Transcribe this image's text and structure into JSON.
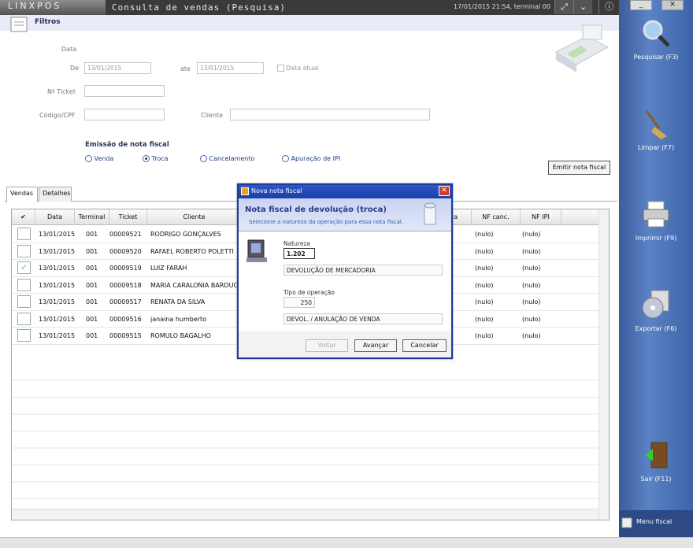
{
  "app": {
    "logo": "LINXPOS",
    "title": "Consulta de vendas (Pesquisa)",
    "status": "17/01/2015 21:54, terminal 00"
  },
  "titlebar_buttons": {
    "expand": "⤢",
    "collapse": "⌄",
    "info": "ⓘ"
  },
  "sidebar": {
    "window_minimize": "_",
    "window_close": "✕",
    "items": [
      {
        "label": "Pesquisar (F3)",
        "icon": "magnifier-icon"
      },
      {
        "label": "Limpar (F7)",
        "icon": "broom-icon"
      },
      {
        "label": "Imprimir (F9)",
        "icon": "printer-icon"
      },
      {
        "label": "Exportar (F6)",
        "icon": "disc-icon"
      },
      {
        "label": "Sair (F11)",
        "icon": "exit-door-icon"
      }
    ],
    "menu_label": "Menu fiscal"
  },
  "filtros": {
    "title": "Filtros",
    "data_label": "Data",
    "de_label": "De",
    "de_value": "13/01/2015",
    "ate_label": "ate",
    "ate_value": "13/01/2015",
    "data_atual_label": "Data atual",
    "ticket_label": "Nº Ticket",
    "codigo_label": "Código/CPF",
    "cliente_label": "Cliente",
    "emissao_label": "Emissão de nota fiscal",
    "radios": [
      "Venda",
      "Troca",
      "Cancelamento",
      "Apuração de IPI"
    ],
    "selected_radio": "Troca",
    "emitir_button": "Emitir nota fiscal"
  },
  "tabs": [
    "Vendas",
    "Detalhes"
  ],
  "grid": {
    "columns": [
      "✔",
      "Data",
      "Terminal",
      "Ticket",
      "Cliente",
      "ca",
      "NF canc.",
      "NF IPI"
    ],
    "rows": [
      {
        "checked": false,
        "data": "13/01/2015",
        "terminal": "001",
        "ticket": "00009521",
        "cliente": "RODRIGO GONÇALVES",
        "nf_canc": "(nulo)",
        "nf_ipi": "(nulo)"
      },
      {
        "checked": false,
        "data": "13/01/2015",
        "terminal": "001",
        "ticket": "00009520",
        "cliente": "RAFAEL ROBERTO POLETTI",
        "nf_canc": "(nulo)",
        "nf_ipi": "(nulo)"
      },
      {
        "checked": true,
        "data": "13/01/2015",
        "terminal": "001",
        "ticket": "00009519",
        "cliente": "LUIZ FARAH",
        "nf_canc": "(nulo)",
        "nf_ipi": "(nulo)"
      },
      {
        "checked": false,
        "data": "13/01/2015",
        "terminal": "001",
        "ticket": "00009518",
        "cliente": "MARIA CARALONIA BARDUCO",
        "nf_canc": "(nulo)",
        "nf_ipi": "(nulo)"
      },
      {
        "checked": false,
        "data": "13/01/2015",
        "terminal": "001",
        "ticket": "00009517",
        "cliente": "RENATA DA SILVA",
        "nf_canc": "(nulo)",
        "nf_ipi": "(nulo)"
      },
      {
        "checked": false,
        "data": "13/01/2015",
        "terminal": "001",
        "ticket": "00009516",
        "cliente": "janaina humberto",
        "nf_canc": "(nulo)",
        "nf_ipi": "(nulo)"
      },
      {
        "checked": false,
        "data": "13/01/2015",
        "terminal": "001",
        "ticket": "00009515",
        "cliente": "ROMULO BAGALHO",
        "nf_canc": "(nulo)",
        "nf_ipi": "(nulo)"
      }
    ]
  },
  "dialog": {
    "title": "Nova nota fiscal",
    "close": "✕",
    "heading": "Nota fiscal de devolução (troca)",
    "subtitle": "Selecione a natureza da operação para essa nota fiscal.",
    "natureza_label": "Natureza",
    "natureza_value": "1.202",
    "natureza_desc": "DEVOLUÇÃO DE MERCADORIA",
    "tipo_label": "Tipo de operação",
    "tipo_value": "250",
    "tipo_desc": "DEVOL. / ANULAÇÃO DE VENDA",
    "buttons": {
      "voltar": "Voltar",
      "avancar": "Avançar",
      "cancelar": "Cancelar"
    }
  }
}
